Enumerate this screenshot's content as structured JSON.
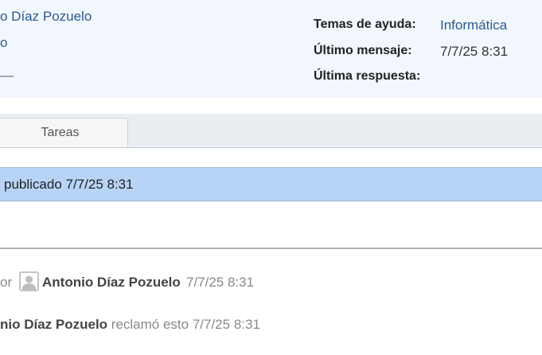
{
  "info_panel": {
    "left_lines": [
      "o Díaz Pozuelo",
      "o",
      "—"
    ],
    "help_topics_label": "Temas de ayuda:",
    "help_topics_value": "Informática",
    "last_message_label": "Último mensaje:",
    "last_message_value": "7/7/25 8:31",
    "last_reply_label": "Última respuesta:",
    "last_reply_value": ""
  },
  "tabs": [
    {
      "label": "Tareas"
    }
  ],
  "post": {
    "header_text": "publicado 7/7/25 8:31"
  },
  "activity": [
    {
      "prefix": "or",
      "author": "Antonio Díaz Pozuelo",
      "time": "7/7/25 8:31"
    },
    {
      "author": "nio Díaz Pozuelo",
      "rest": " reclamó esto 7/7/25 8:31"
    }
  ],
  "colors": {
    "panel_bg": "#f1f7fd",
    "link": "#2c5a8a",
    "post_header_bg": "#b7d4f7",
    "tabs_bg": "#eaeef3"
  },
  "icons": {
    "avatar": "user-avatar-icon"
  }
}
